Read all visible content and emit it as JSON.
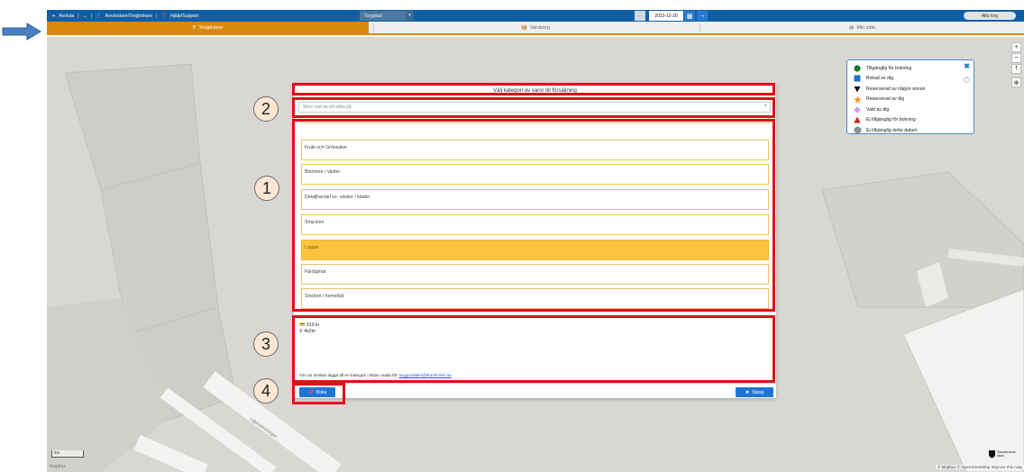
{
  "topbar": {
    "avsluta": "Avsluta",
    "user": "Användare/Torgbokare",
    "help": "Hjälp/Support",
    "torgplats": "Torgplats",
    "date": "2023-12-20",
    "alla_torg": "Alla torg"
  },
  "tabs": [
    {
      "label": "Torgplatser",
      "icon": "map-marker-icon"
    },
    {
      "label": "Varukorg",
      "icon": "basket-icon"
    },
    {
      "label": "Min sida",
      "icon": "calendar-icon"
    }
  ],
  "legend": {
    "items": [
      {
        "label": "Tillgänglig för bokning",
        "icon": "green-circle",
        "color": "#1b7a2f"
      },
      {
        "label": "Bokad av dig",
        "icon": "blue-square",
        "color": "#1a73c9"
      },
      {
        "label": "Reserverad av någon annan",
        "icon": "black-triangle-down",
        "color": "#111111"
      },
      {
        "label": "Reserverad av dig",
        "icon": "orange-star",
        "color": "#f09a23"
      },
      {
        "label": "Vald av dig",
        "icon": "pink-diamond",
        "color": "#d89ee3"
      },
      {
        "label": "Ej tillgänglig för bokning",
        "icon": "red-triangle-up",
        "color": "#d11f1f"
      },
      {
        "label": "Ej tillgänglig detta datum",
        "icon": "grey-hexagon",
        "color": "#8f8f8f"
      }
    ]
  },
  "modal": {
    "title": "Välj kategori av varor till försäljning",
    "search_placeholder": "Skriv vad du vill söka på",
    "categories": [
      {
        "label": "Frukt och Grönsaker",
        "selected": false
      },
      {
        "label": "Blommor / växter",
        "selected": false
      },
      {
        "label": "Detaljhandel ex: väskor / kläder",
        "selected": false
      },
      {
        "label": "Smycken",
        "selected": false
      },
      {
        "label": "Loppis",
        "selected": true
      },
      {
        "label": "Färdigmat",
        "selected": false
      },
      {
        "label": "Snickeri / hemslöjd",
        "selected": false
      }
    ],
    "price": "310 kr",
    "size": "4x2m",
    "footnote_text": "Om du önskar lägga till en kategori i listan maila till:",
    "footnote_email": "torgportalen@stockholm.se",
    "book_label": "Boka",
    "close_label": "Stäng"
  },
  "annotations": [
    "1",
    "2",
    "3",
    "4"
  ],
  "map": {
    "scale": "5m",
    "attribution": "© Mapbox © OpenStreetMap Improve this map",
    "logo": "mapbox",
    "street": "Liljeholmstorget",
    "city_logo": "Stockholms stad"
  },
  "colors": {
    "topbar": "#0f5fa6",
    "accent": "#d7880d",
    "selected": "#fdc33e",
    "annotation_red": "#e10f1a",
    "button_blue": "#1f75d6"
  }
}
